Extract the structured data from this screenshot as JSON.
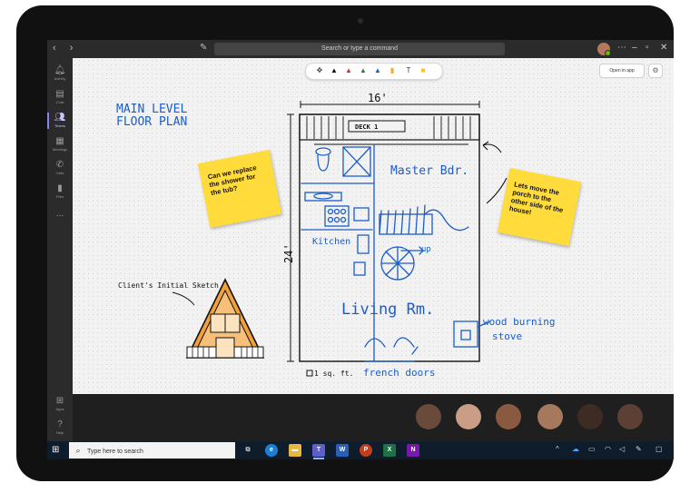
{
  "window": {
    "search_placeholder": "Search or type a command"
  },
  "rail": {
    "items": [
      {
        "label": "Activity",
        "icon": "bell-icon"
      },
      {
        "label": "Chat",
        "icon": "chat-icon"
      },
      {
        "label": "Teams",
        "icon": "teams-icon",
        "active": true
      },
      {
        "label": "Meetings",
        "icon": "calendar-icon"
      },
      {
        "label": "Calls",
        "icon": "phone-icon"
      },
      {
        "label": "Files",
        "icon": "file-icon"
      }
    ],
    "more": "...",
    "apps_label": "Apps",
    "help_label": "Help"
  },
  "board": {
    "open_in_app": "Open in app",
    "title_line1": "MAIN LEVEL",
    "title_line2": "FLOOR PLAN",
    "dim_width": "16'",
    "dim_height": "24'",
    "deck_label": "DECK 1",
    "master_label": "Master Bdr.",
    "kitchen_label": "Kitchen",
    "up_label": "up",
    "living_label": "Living Rm.",
    "stove_label_1": "wood burning",
    "stove_label_2": "stove",
    "doors_label": "french doors",
    "scale_label": "1 sq. ft.",
    "sketch_label": "Client's Initial Sketch",
    "note_left": "Can we replace the shower for the tub?",
    "note_right": "Lets move the porch to the other side of the house!"
  },
  "taskbar": {
    "search_placeholder": "Type here to search"
  },
  "colors": {
    "ink_blue": "#1c5dc8",
    "sticky_yellow": "#ffdc3c",
    "teams_accent": "#7f85f5",
    "taskbar_bg": "#0f1c2c"
  }
}
